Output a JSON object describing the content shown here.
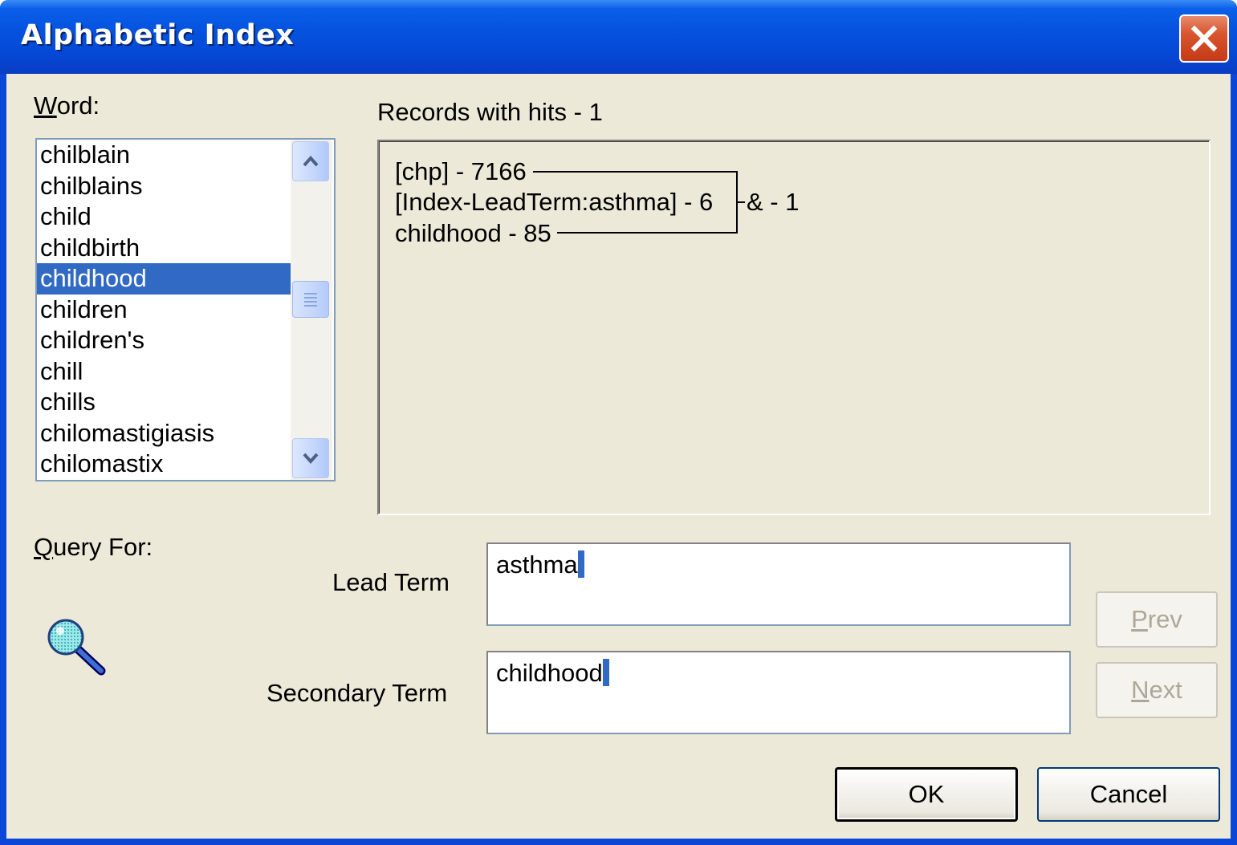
{
  "window": {
    "title": "Alphabetic Index"
  },
  "word_label": {
    "accel": "W",
    "rest": "ord:"
  },
  "word_list": {
    "items": [
      "chilblain",
      "chilblains",
      "child",
      "childbirth",
      "childhood",
      "children",
      "children's",
      "chill",
      "chills",
      "chilomastigiasis",
      "chilomastix"
    ],
    "selected": "childhood"
  },
  "records": {
    "header": "Records with hits - 1",
    "line1": "[chp] - 7166",
    "line2": "[Index-LeadTerm:asthma] - 6",
    "line3": "childhood - 85",
    "combined": "& - 1"
  },
  "query_label": {
    "accel": "Q",
    "rest": "uery For:"
  },
  "lead_term": {
    "label": "Lead Term",
    "value": "asthma"
  },
  "secondary_term": {
    "label": "Secondary Term",
    "value": "childhood"
  },
  "buttons": {
    "prev_accel": "P",
    "prev_rest": "rev",
    "next_accel": "N",
    "next_rest": "ext",
    "ok": "OK",
    "cancel": "Cancel"
  },
  "colors": {
    "titlebar": "#0553e0",
    "dialog_bg": "#ece9d8",
    "selection": "#316ac5"
  },
  "icons": [
    "close-icon",
    "scroll-up-icon",
    "scroll-down-icon",
    "magnifier-icon"
  ]
}
